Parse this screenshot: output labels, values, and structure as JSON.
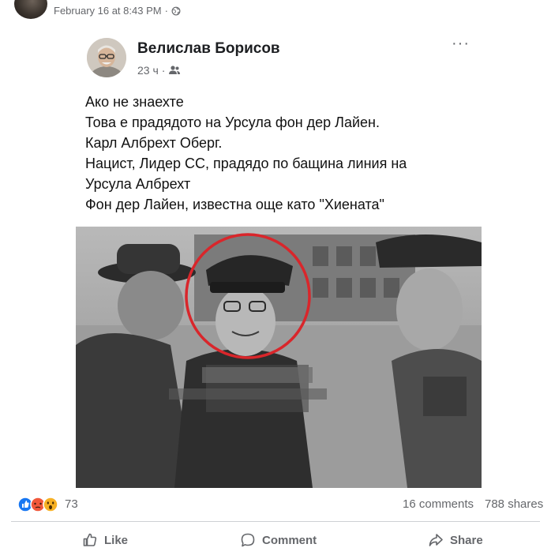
{
  "header": {
    "timestamp": "February 16 at 8:43 PM",
    "separator": "·",
    "privacy_icon": "globe-icon"
  },
  "post": {
    "author_name": "Велислав Борисов",
    "time_ago": "23 ч",
    "separator": "·",
    "audience_icon": "friends-icon",
    "more_icon": "more-options-icon",
    "more_label": "···",
    "text_lines": [
      "Ако не знаехте",
      "Това е прадядото на Урсула фон дер Лайен.",
      "Карл Албрехт Оберг.",
      "Нацист, Лидер СС, прадядо по бащина линия на",
      "Урсула Албрехт",
      "Фон дер Лайен, известна още като \"Хиената\""
    ]
  },
  "engagement": {
    "reaction_icons": [
      "like-reaction-icon",
      "angry-reaction-icon",
      "wow-reaction-icon"
    ],
    "reaction_count": "73",
    "comments": "16 comments",
    "shares": "788 shares"
  },
  "actions": {
    "like_label": "Like",
    "comment_label": "Comment",
    "share_label": "Share"
  },
  "colors": {
    "secondary_text": "#65676b",
    "like_blue": "#1877f2",
    "angry_orange": "#f0573a",
    "wow_yellow": "#f7b125",
    "circle_red": "#d9262b"
  }
}
